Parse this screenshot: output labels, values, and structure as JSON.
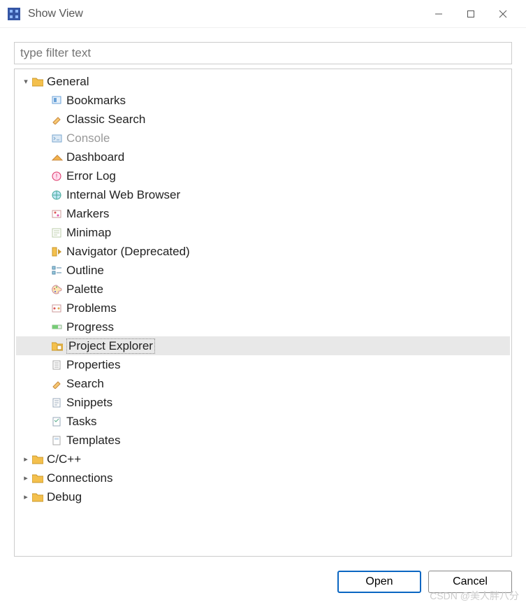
{
  "window": {
    "title": "Show View"
  },
  "filter": {
    "placeholder": "type filter text"
  },
  "tree": {
    "general": {
      "label": "General",
      "expanded": true,
      "items": [
        {
          "id": "bookmarks",
          "label": "Bookmarks"
        },
        {
          "id": "classic-search",
          "label": "Classic Search"
        },
        {
          "id": "console",
          "label": "Console",
          "dim": true
        },
        {
          "id": "dashboard",
          "label": "Dashboard"
        },
        {
          "id": "error-log",
          "label": "Error Log"
        },
        {
          "id": "internal-web-browser",
          "label": "Internal Web Browser"
        },
        {
          "id": "markers",
          "label": "Markers"
        },
        {
          "id": "minimap",
          "label": "Minimap"
        },
        {
          "id": "navigator",
          "label": "Navigator (Deprecated)"
        },
        {
          "id": "outline",
          "label": "Outline"
        },
        {
          "id": "palette",
          "label": "Palette"
        },
        {
          "id": "problems",
          "label": "Problems"
        },
        {
          "id": "progress",
          "label": "Progress"
        },
        {
          "id": "project-explorer",
          "label": "Project Explorer",
          "selected": true
        },
        {
          "id": "properties",
          "label": "Properties"
        },
        {
          "id": "search",
          "label": "Search"
        },
        {
          "id": "snippets",
          "label": "Snippets"
        },
        {
          "id": "tasks",
          "label": "Tasks"
        },
        {
          "id": "templates",
          "label": "Templates"
        }
      ]
    },
    "cpp": {
      "label": "C/C++",
      "expanded": false
    },
    "connections": {
      "label": "Connections",
      "expanded": false
    },
    "debug": {
      "label": "Debug",
      "expanded": false
    }
  },
  "buttons": {
    "open": "Open",
    "cancel": "Cancel"
  },
  "watermark": "CSDN @美人胖八分"
}
